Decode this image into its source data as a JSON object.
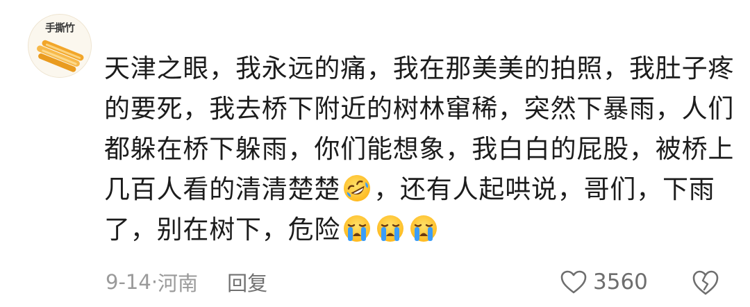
{
  "avatar": {
    "logo_text": "手撕竹",
    "icon": "fried-dough-sticks-image"
  },
  "comment": {
    "lines": [
      "天津之眼，我永远的痛，我在那美美的拍照，我肚子疼",
      "的要死，我去桥下附近的树林窜稀，突然下暴雨，人们",
      "都躲在桥下躲雨，你们能想象，我白白的屁股，被桥上",
      "几百人看的清清楚楚",
      "，还有人起哄说，哥们，下雨",
      "了，别在树下，危险"
    ],
    "emojis": [
      "rolling-on-floor-laughing-emoji",
      "loudly-crying-face-emoji",
      "loudly-crying-face-emoji",
      "loudly-crying-face-emoji"
    ]
  },
  "meta": {
    "date": "9-14",
    "separator": "·",
    "location": "河南",
    "reply_label": "回复"
  },
  "actions": {
    "like_icon": "heart-outline-icon",
    "like_count": "3560",
    "dislike_icon": "broken-heart-outline-icon"
  },
  "colors": {
    "text": "#1c1c1c",
    "meta": "#9a9a9a",
    "emoji_face": "#ffc83d",
    "tears": "#3b9df8"
  }
}
